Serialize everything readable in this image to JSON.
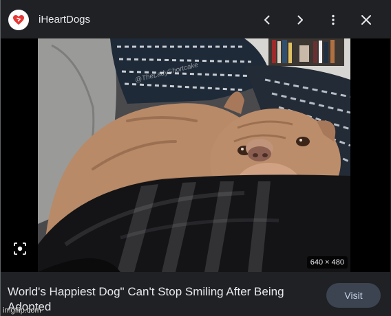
{
  "header": {
    "site_name": "iHeartDogs",
    "logo_icon": "heart-logo-icon",
    "actions": [
      "previous",
      "next",
      "more",
      "close"
    ]
  },
  "image": {
    "watermark": "@TheLadyShortcake",
    "dimensions": "640 × 480"
  },
  "result": {
    "title": "World's Happiest Dog\" Can't Stop Smiling After Being Adopted",
    "visit_label": "Visit"
  },
  "overlay": {
    "watermark_site": "imgflip.com"
  },
  "colors": {
    "background": "#202124",
    "text": "#e8eaed",
    "visit_button": "#3c4451",
    "logo_heart": "#e53935"
  }
}
